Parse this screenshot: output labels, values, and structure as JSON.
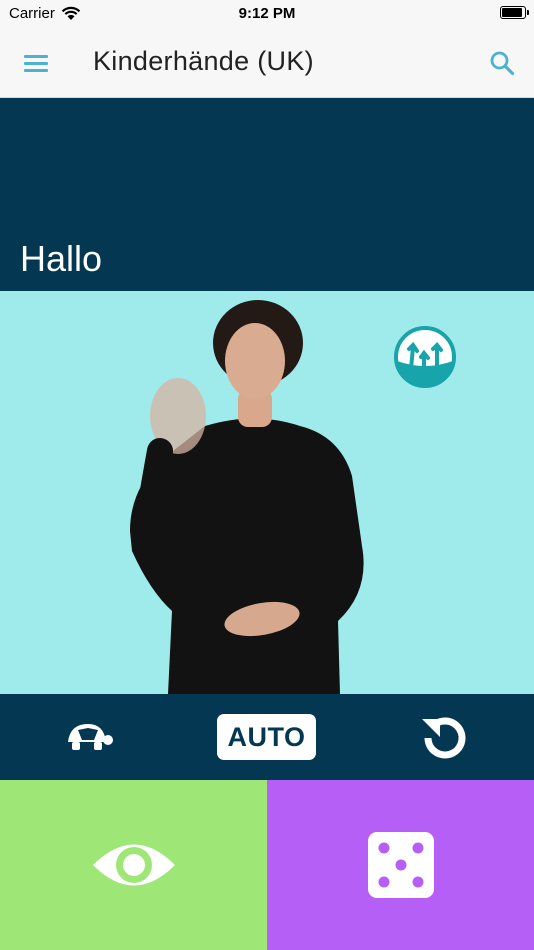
{
  "status_bar": {
    "carrier": "Carrier",
    "time": "9:12 PM",
    "icons": [
      "wifi-icon",
      "battery-icon"
    ]
  },
  "header": {
    "title": "Kinderhände (UK)",
    "icons": [
      "hamburger-menu-icon",
      "search-icon"
    ]
  },
  "word": {
    "label": "Hallo"
  },
  "video": {
    "description_icon": "hands-logo-icon"
  },
  "controls": {
    "auto_label": "AUTO",
    "icons": [
      "turtle-slow-icon",
      "replay-icon"
    ]
  },
  "tiles": {
    "show_icon": "eye-icon",
    "random_icon": "dice-icon"
  },
  "colors": {
    "accent": "#4db2cf",
    "navy": "#033752",
    "video_bg": "#9febeb",
    "green_tile": "#9ee676",
    "purple_tile": "#b65ff7"
  }
}
